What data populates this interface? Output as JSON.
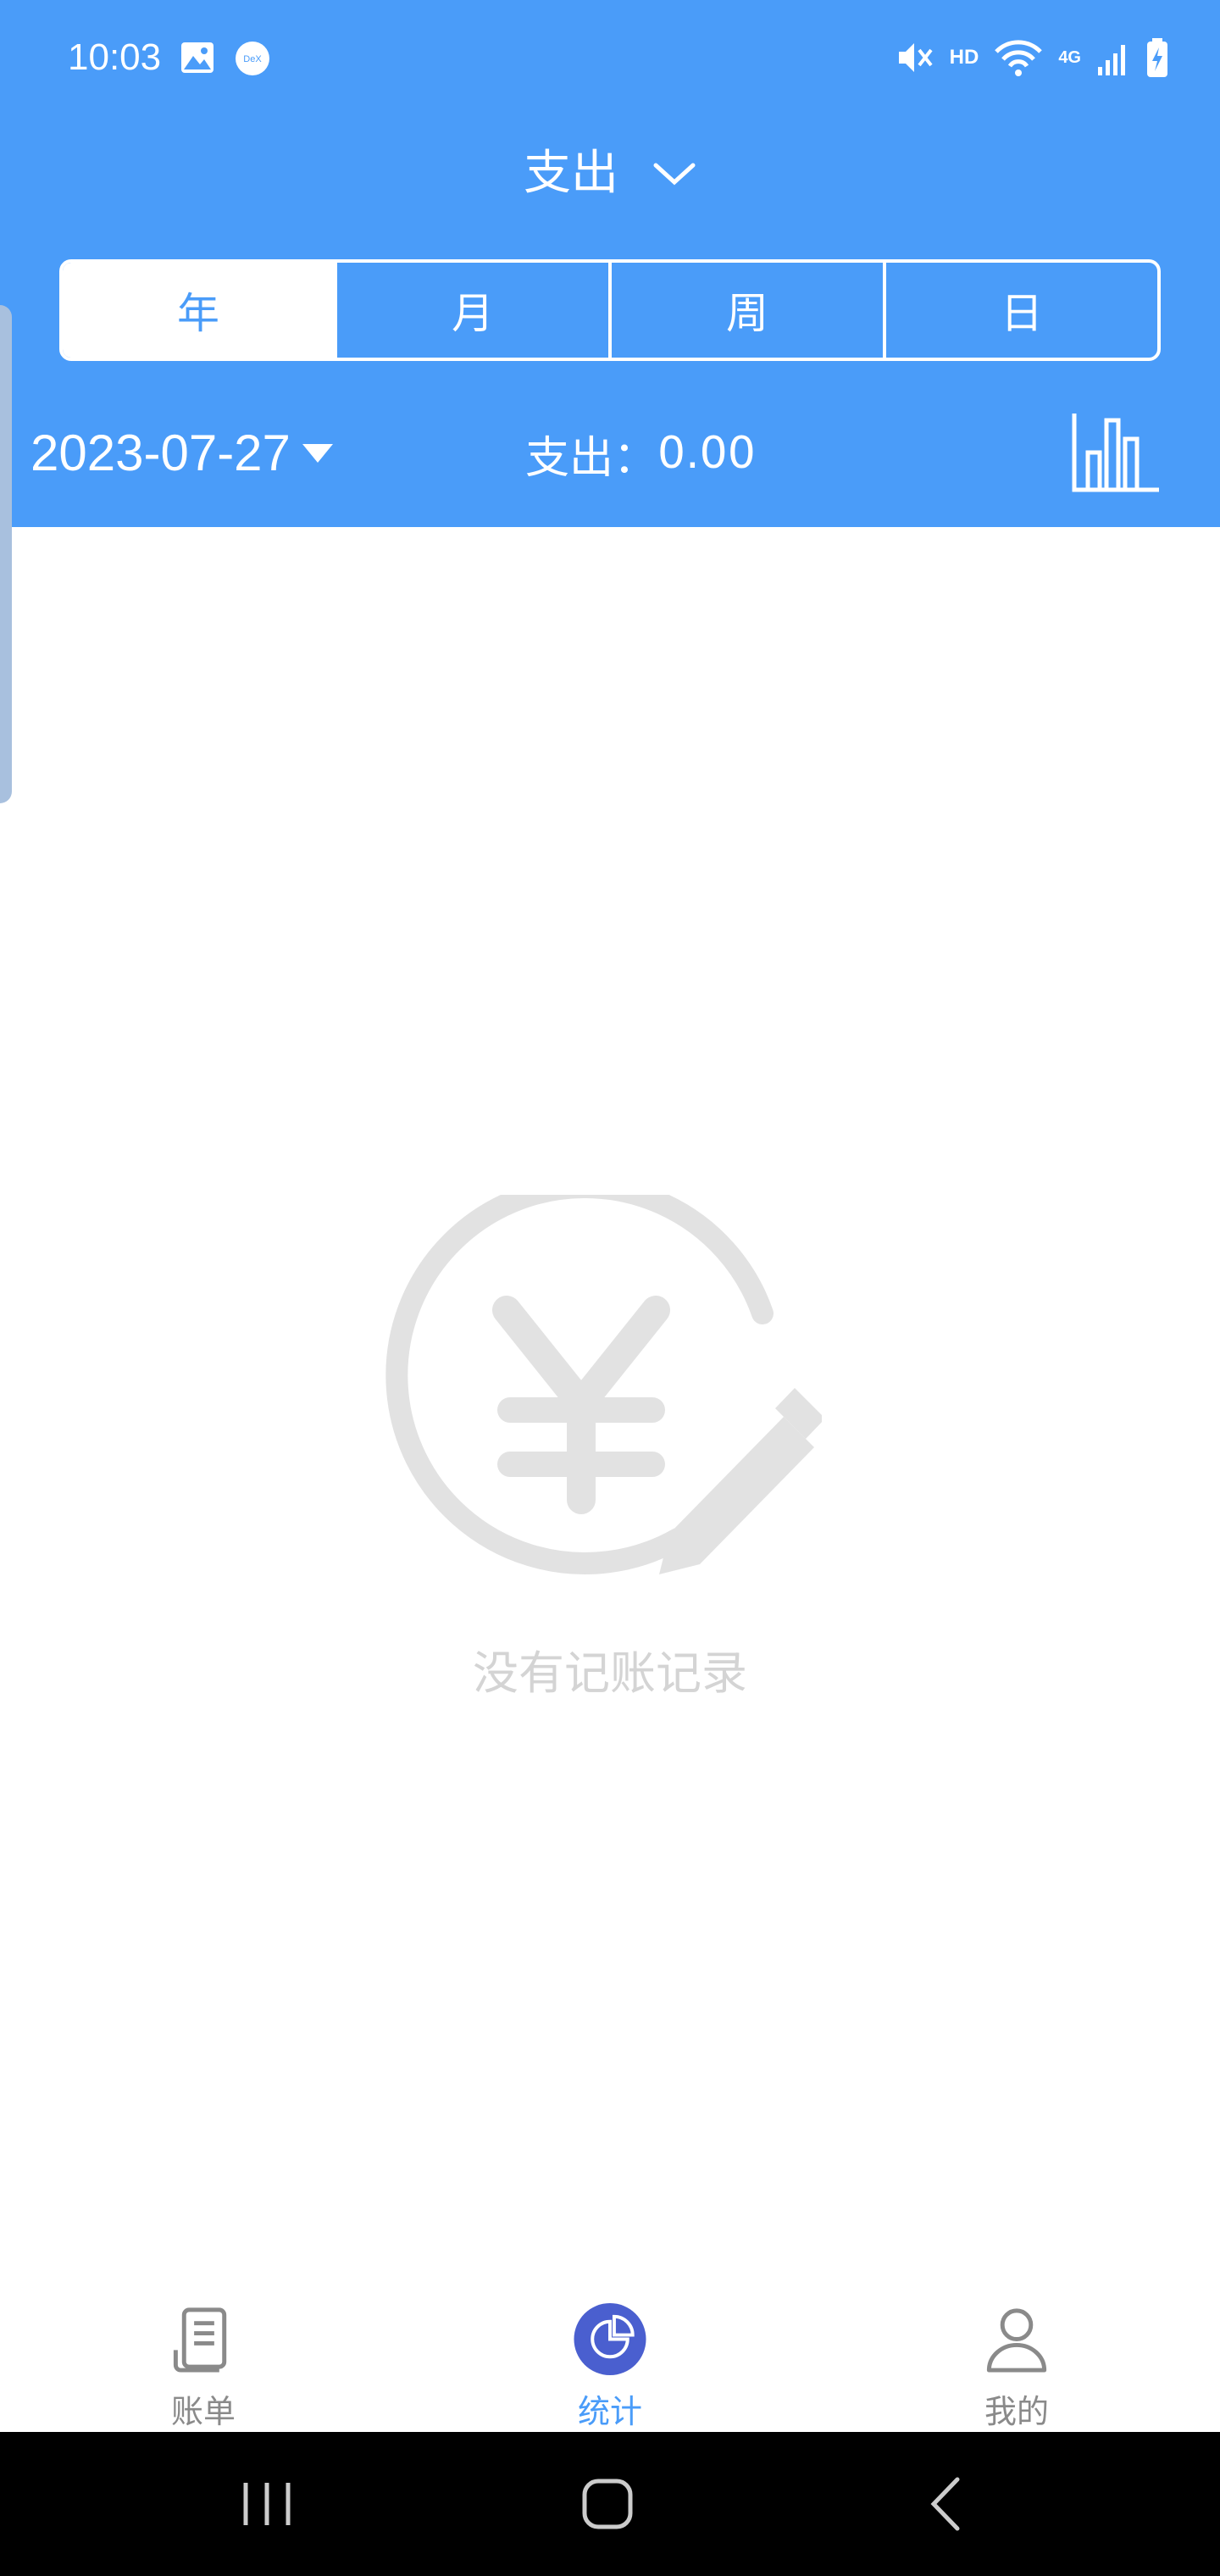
{
  "status_bar": {
    "time": "10:03",
    "hd": "HD",
    "network": "4G"
  },
  "header": {
    "title": "支出",
    "tabs": [
      {
        "label": "年",
        "active": true
      },
      {
        "label": "月",
        "active": false
      },
      {
        "label": "周",
        "active": false
      },
      {
        "label": "日",
        "active": false
      }
    ],
    "date": "2023-07-27",
    "total_label": "支出：",
    "total_value": "0.00"
  },
  "empty_state": {
    "message": "没有记账记录",
    "icon": "yen-pencil-icon"
  },
  "bottom_nav": {
    "items": [
      {
        "label": "账单",
        "icon": "bill-icon",
        "active": false
      },
      {
        "label": "统计",
        "icon": "stats-pie-icon",
        "active": true
      },
      {
        "label": "我的",
        "icon": "profile-icon",
        "active": false
      }
    ]
  },
  "colors": {
    "primary": "#4a9cf9",
    "nav_active": "#4a5fcf",
    "muted": "#8a8a8a",
    "empty": "#e2e2e2"
  }
}
